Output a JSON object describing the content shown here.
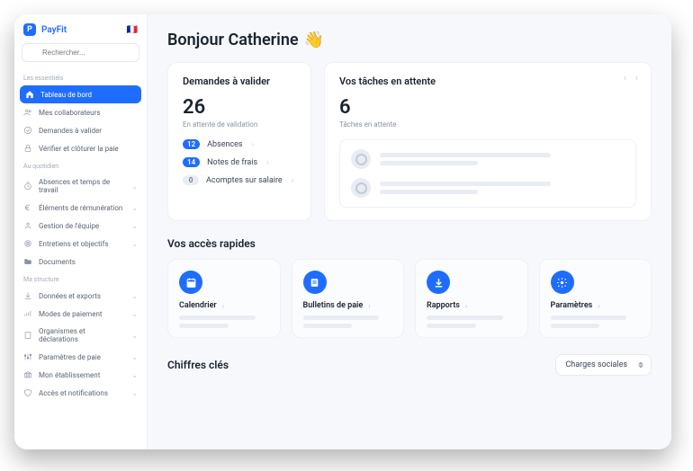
{
  "brand": {
    "name": "PayFit",
    "logo_letter": "P"
  },
  "search": {
    "placeholder": "Rechercher..."
  },
  "sidebar": {
    "sections": [
      {
        "label": "Les essentiels",
        "items": [
          {
            "label": "Tableau de bord",
            "icon": "home",
            "active": true
          },
          {
            "label": "Mes collaborateurs",
            "icon": "users"
          },
          {
            "label": "Demandes à valider",
            "icon": "check-circle"
          },
          {
            "label": "Vérifier et clôturer la paie",
            "icon": "lock"
          }
        ]
      },
      {
        "label": "Au quotidien",
        "items": [
          {
            "label": "Absences et temps de travail",
            "icon": "clock",
            "expandable": true
          },
          {
            "label": "Éléments de rémunération",
            "icon": "euro",
            "expandable": true
          },
          {
            "label": "Gestion de l'équipe",
            "icon": "team",
            "expandable": true
          },
          {
            "label": "Entretiens et objectifs",
            "icon": "target",
            "expandable": true
          },
          {
            "label": "Documents",
            "icon": "folder"
          }
        ]
      },
      {
        "label": "Ma structure",
        "items": [
          {
            "label": "Données et exports",
            "icon": "download",
            "expandable": true
          },
          {
            "label": "Modes de paiement",
            "icon": "signal",
            "expandable": true
          },
          {
            "label": "Organismes et déclarations",
            "icon": "building",
            "expandable": true
          },
          {
            "label": "Paramètres de paie",
            "icon": "sliders",
            "expandable": true
          },
          {
            "label": "Mon établissement",
            "icon": "bank",
            "expandable": true
          },
          {
            "label": "Accès et notifications",
            "icon": "shield",
            "expandable": true
          }
        ]
      }
    ]
  },
  "greeting": {
    "text": "Bonjour Catherine",
    "emoji": "👋"
  },
  "requests_card": {
    "title": "Demandes à valider",
    "count": "26",
    "subtitle": "En attente de validation",
    "items": [
      {
        "count": "12",
        "label": "Absences",
        "variant": "blue"
      },
      {
        "count": "14",
        "label": "Notes de frais",
        "variant": "blue"
      },
      {
        "count": "0",
        "label": "Acomptes sur salaire",
        "variant": "grey"
      }
    ]
  },
  "tasks_card": {
    "title": "Vos tâches en attente",
    "count": "6",
    "subtitle": "Tâches en attente"
  },
  "quick_access": {
    "title": "Vos accès rapides",
    "items": [
      {
        "label": "Calendrier",
        "icon": "calendar"
      },
      {
        "label": "Bulletins de paie",
        "icon": "payslip"
      },
      {
        "label": "Rapports",
        "icon": "download-circle"
      },
      {
        "label": "Paramètres",
        "icon": "gear"
      }
    ]
  },
  "key_figures": {
    "title": "Chiffres clés",
    "select_value": "Charges sociales"
  }
}
